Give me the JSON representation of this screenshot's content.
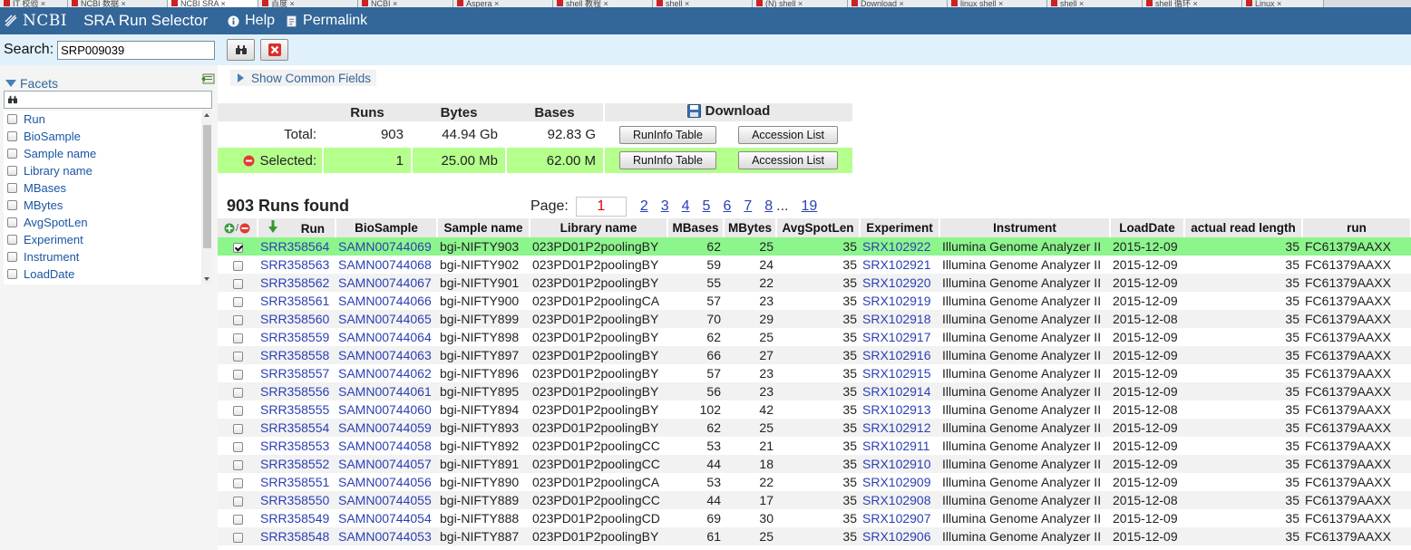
{
  "browser_tabs": [
    {
      "label": "IT 校验 ×",
      "active": false
    },
    {
      "label": "NCBI 数据 ×",
      "active": false
    },
    {
      "label": "NCBI SRA ×",
      "active": true
    },
    {
      "label": "百度 ×",
      "active": false
    },
    {
      "label": "NCBI ×",
      "active": false
    },
    {
      "label": "Aspera ×",
      "active": false
    },
    {
      "label": "shell 教程 ×",
      "active": false
    },
    {
      "label": "shell ×",
      "active": false
    },
    {
      "label": "(N) shell ×",
      "active": false
    },
    {
      "label": "Download ×",
      "active": false
    },
    {
      "label": "linux shell ×",
      "active": false
    },
    {
      "label": "shell ×",
      "active": false
    },
    {
      "label": "shell 循环 ×",
      "active": false
    },
    {
      "label": "Linux ×",
      "active": false
    }
  ],
  "header": {
    "logo_text": "NCBI",
    "app_title": "SRA Run Selector",
    "help_label": "Help",
    "permalink_label": "Permalink"
  },
  "search": {
    "label": "Search:",
    "value": "SRP009039"
  },
  "facets": {
    "title": "Facets",
    "items": [
      "Run",
      "BioSample",
      "Sample name",
      "Library name",
      "MBases",
      "MBytes",
      "AvgSpotLen",
      "Experiment",
      "Instrument",
      "LoadDate"
    ]
  },
  "show_common_fields": "Show Common Fields",
  "summary": {
    "headers": {
      "runs": "Runs",
      "bytes": "Bytes",
      "bases": "Bases",
      "download": "Download"
    },
    "total": {
      "label": "Total:",
      "runs": "903",
      "bytes": "44.94 Gb",
      "bases": "92.83 G"
    },
    "selected": {
      "label": "Selected:",
      "runs": "1",
      "bytes": "25.00 Mb",
      "bases": "62.00 M"
    },
    "runinfo_button": "RunInfo Table",
    "accession_button": "Accession List"
  },
  "results": {
    "count_label": "903 Runs found"
  },
  "pager": {
    "label": "Page:",
    "current": "1",
    "pages": [
      "2",
      "3",
      "4",
      "5",
      "6",
      "7",
      "8"
    ],
    "ellipsis": "...",
    "last": "19"
  },
  "grid": {
    "columns": [
      "Run",
      "BioSample",
      "Sample name",
      "Library name",
      "MBases",
      "MBytes",
      "AvgSpotLen",
      "Experiment",
      "Instrument",
      "LoadDate",
      "actual read length",
      "run"
    ],
    "rows": [
      {
        "checked": true,
        "run": "SRR358564",
        "biosample": "SAMN00744069",
        "sample": "bgi-NIFTY903",
        "library": "023PD01P2poolingBY",
        "mbases": "62",
        "mbytes": "25",
        "avgspot": "35",
        "experiment": "SRX102922",
        "instrument": "Illumina Genome Analyzer II",
        "loaddate": "2015-12-09",
        "readlen": "35",
        "runid": "FC61379AAXX"
      },
      {
        "checked": false,
        "run": "SRR358563",
        "biosample": "SAMN00744068",
        "sample": "bgi-NIFTY902",
        "library": "023PD01P2poolingBY",
        "mbases": "59",
        "mbytes": "24",
        "avgspot": "35",
        "experiment": "SRX102921",
        "instrument": "Illumina Genome Analyzer II",
        "loaddate": "2015-12-09",
        "readlen": "35",
        "runid": "FC61379AAXX"
      },
      {
        "checked": false,
        "run": "SRR358562",
        "biosample": "SAMN00744067",
        "sample": "bgi-NIFTY901",
        "library": "023PD01P2poolingBY",
        "mbases": "55",
        "mbytes": "22",
        "avgspot": "35",
        "experiment": "SRX102920",
        "instrument": "Illumina Genome Analyzer II",
        "loaddate": "2015-12-09",
        "readlen": "35",
        "runid": "FC61379AAXX"
      },
      {
        "checked": false,
        "run": "SRR358561",
        "biosample": "SAMN00744066",
        "sample": "bgi-NIFTY900",
        "library": "023PD01P2poolingCA",
        "mbases": "57",
        "mbytes": "23",
        "avgspot": "35",
        "experiment": "SRX102919",
        "instrument": "Illumina Genome Analyzer II",
        "loaddate": "2015-12-09",
        "readlen": "35",
        "runid": "FC61379AAXX"
      },
      {
        "checked": false,
        "run": "SRR358560",
        "biosample": "SAMN00744065",
        "sample": "bgi-NIFTY899",
        "library": "023PD01P2poolingBY",
        "mbases": "70",
        "mbytes": "29",
        "avgspot": "35",
        "experiment": "SRX102918",
        "instrument": "Illumina Genome Analyzer II",
        "loaddate": "2015-12-08",
        "readlen": "35",
        "runid": "FC61379AAXX"
      },
      {
        "checked": false,
        "run": "SRR358559",
        "biosample": "SAMN00744064",
        "sample": "bgi-NIFTY898",
        "library": "023PD01P2poolingBY",
        "mbases": "62",
        "mbytes": "25",
        "avgspot": "35",
        "experiment": "SRX102917",
        "instrument": "Illumina Genome Analyzer II",
        "loaddate": "2015-12-09",
        "readlen": "35",
        "runid": "FC61379AAXX"
      },
      {
        "checked": false,
        "run": "SRR358558",
        "biosample": "SAMN00744063",
        "sample": "bgi-NIFTY897",
        "library": "023PD01P2poolingBY",
        "mbases": "66",
        "mbytes": "27",
        "avgspot": "35",
        "experiment": "SRX102916",
        "instrument": "Illumina Genome Analyzer II",
        "loaddate": "2015-12-09",
        "readlen": "35",
        "runid": "FC61379AAXX"
      },
      {
        "checked": false,
        "run": "SRR358557",
        "biosample": "SAMN00744062",
        "sample": "bgi-NIFTY896",
        "library": "023PD01P2poolingBY",
        "mbases": "57",
        "mbytes": "23",
        "avgspot": "35",
        "experiment": "SRX102915",
        "instrument": "Illumina Genome Analyzer II",
        "loaddate": "2015-12-09",
        "readlen": "35",
        "runid": "FC61379AAXX"
      },
      {
        "checked": false,
        "run": "SRR358556",
        "biosample": "SAMN00744061",
        "sample": "bgi-NIFTY895",
        "library": "023PD01P2poolingBY",
        "mbases": "56",
        "mbytes": "23",
        "avgspot": "35",
        "experiment": "SRX102914",
        "instrument": "Illumina Genome Analyzer II",
        "loaddate": "2015-12-09",
        "readlen": "35",
        "runid": "FC61379AAXX"
      },
      {
        "checked": false,
        "run": "SRR358555",
        "biosample": "SAMN00744060",
        "sample": "bgi-NIFTY894",
        "library": "023PD01P2poolingBY",
        "mbases": "102",
        "mbytes": "42",
        "avgspot": "35",
        "experiment": "SRX102913",
        "instrument": "Illumina Genome Analyzer II",
        "loaddate": "2015-12-08",
        "readlen": "35",
        "runid": "FC61379AAXX"
      },
      {
        "checked": false,
        "run": "SRR358554",
        "biosample": "SAMN00744059",
        "sample": "bgi-NIFTY893",
        "library": "023PD01P2poolingBY",
        "mbases": "62",
        "mbytes": "25",
        "avgspot": "35",
        "experiment": "SRX102912",
        "instrument": "Illumina Genome Analyzer II",
        "loaddate": "2015-12-09",
        "readlen": "35",
        "runid": "FC61379AAXX"
      },
      {
        "checked": false,
        "run": "SRR358553",
        "biosample": "SAMN00744058",
        "sample": "bgi-NIFTY892",
        "library": "023PD01P2poolingCC",
        "mbases": "53",
        "mbytes": "21",
        "avgspot": "35",
        "experiment": "SRX102911",
        "instrument": "Illumina Genome Analyzer II",
        "loaddate": "2015-12-09",
        "readlen": "35",
        "runid": "FC61379AAXX"
      },
      {
        "checked": false,
        "run": "SRR358552",
        "biosample": "SAMN00744057",
        "sample": "bgi-NIFTY891",
        "library": "023PD01P2poolingCC",
        "mbases": "44",
        "mbytes": "18",
        "avgspot": "35",
        "experiment": "SRX102910",
        "instrument": "Illumina Genome Analyzer II",
        "loaddate": "2015-12-09",
        "readlen": "35",
        "runid": "FC61379AAXX"
      },
      {
        "checked": false,
        "run": "SRR358551",
        "biosample": "SAMN00744056",
        "sample": "bgi-NIFTY890",
        "library": "023PD01P2poolingCA",
        "mbases": "53",
        "mbytes": "22",
        "avgspot": "35",
        "experiment": "SRX102909",
        "instrument": "Illumina Genome Analyzer II",
        "loaddate": "2015-12-09",
        "readlen": "35",
        "runid": "FC61379AAXX"
      },
      {
        "checked": false,
        "run": "SRR358550",
        "biosample": "SAMN00744055",
        "sample": "bgi-NIFTY889",
        "library": "023PD01P2poolingCC",
        "mbases": "44",
        "mbytes": "17",
        "avgspot": "35",
        "experiment": "SRX102908",
        "instrument": "Illumina Genome Analyzer II",
        "loaddate": "2015-12-08",
        "readlen": "35",
        "runid": "FC61379AAXX"
      },
      {
        "checked": false,
        "run": "SRR358549",
        "biosample": "SAMN00744054",
        "sample": "bgi-NIFTY888",
        "library": "023PD01P2poolingCD",
        "mbases": "69",
        "mbytes": "30",
        "avgspot": "35",
        "experiment": "SRX102907",
        "instrument": "Illumina Genome Analyzer II",
        "loaddate": "2015-12-09",
        "readlen": "35",
        "runid": "FC61379AAXX"
      },
      {
        "checked": false,
        "run": "SRR358548",
        "biosample": "SAMN00744053",
        "sample": "bgi-NIFTY887",
        "library": "023PD01P2poolingBY",
        "mbases": "61",
        "mbytes": "25",
        "avgspot": "35",
        "experiment": "SRX102906",
        "instrument": "Illumina Genome Analyzer II",
        "loaddate": "2015-12-09",
        "readlen": "35",
        "runid": "FC61379AAXX"
      }
    ]
  },
  "colors": {
    "header_blue": "#336699",
    "search_bg": "#e1f1fb",
    "selected_row": "#8cf58c",
    "selected_summary": "#b5ff8c",
    "link_blue": "#2b3fb5"
  }
}
